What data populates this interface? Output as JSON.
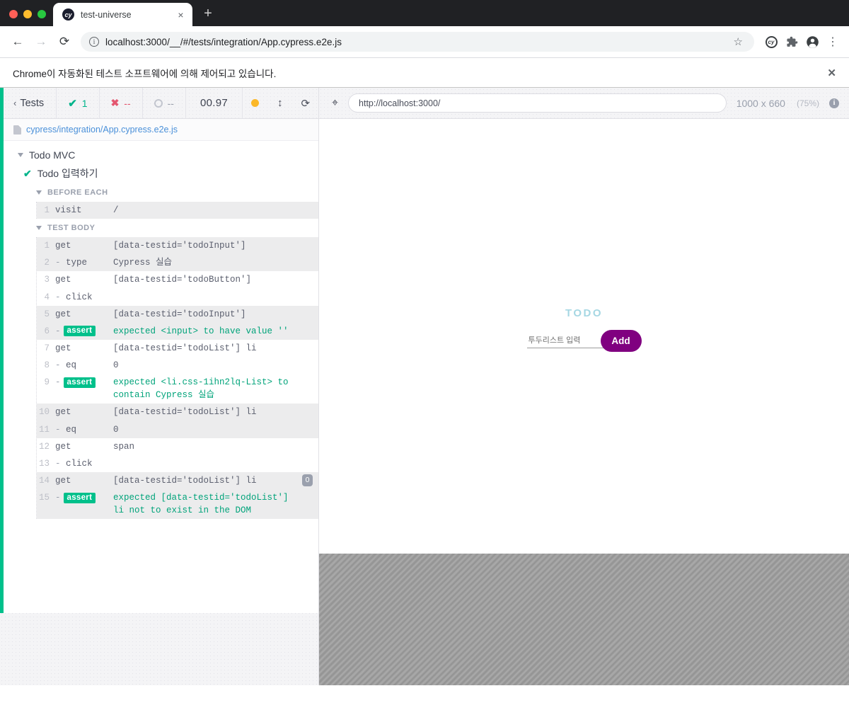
{
  "browser": {
    "tab": {
      "title": "test-universe",
      "favicon": "cy",
      "close": "×"
    },
    "new_tab": "+",
    "nav": {
      "back": "←",
      "forward": "→",
      "reload": "⟳"
    },
    "omnibox": {
      "info": "i",
      "url": "localhost:3000/__/#/tests/integration/App.cypress.e2e.js",
      "star": "☆"
    },
    "toolbar_icons": {
      "extension_cy": "cy",
      "puzzle": "❖",
      "profile": "●",
      "menu": "⋮"
    },
    "automation_notice": {
      "text": "Chrome이 자동화된 테스트 소프트웨어에 의해 제어되고 있습니다.",
      "close": "✕"
    }
  },
  "reporter": {
    "header": {
      "back_chevron": "‹",
      "tests_label": "Tests",
      "pass_icon": "✔",
      "pass_count": "1",
      "fail_icon": "✖",
      "fail_count": "--",
      "pending_count": "--",
      "duration": "00.97",
      "auto_scroll_icon": "↕",
      "restart_icon": "⟳"
    },
    "spec_path": "cypress/integration/App.cypress.e2e.js",
    "suite": {
      "name": "Todo MVC"
    },
    "test": {
      "name": "Todo 입력하기"
    },
    "hooks": [
      {
        "label": "BEFORE EACH",
        "commands": [
          {
            "num": "1",
            "name": "visit",
            "message": "/",
            "type": "parent",
            "alt": true,
            "badge": ""
          }
        ]
      },
      {
        "label": "TEST BODY",
        "commands": [
          {
            "num": "1",
            "name": "get",
            "message": "[data-testid='todoInput']",
            "type": "parent",
            "alt": true,
            "badge": ""
          },
          {
            "num": "2",
            "name": "type",
            "message": "Cypress 실습",
            "type": "child",
            "alt": true,
            "badge": ""
          },
          {
            "num": "3",
            "name": "get",
            "message": "[data-testid='todoButton']",
            "type": "parent",
            "alt": false,
            "badge": ""
          },
          {
            "num": "4",
            "name": "click",
            "message": "",
            "type": "child",
            "alt": false,
            "badge": ""
          },
          {
            "num": "5",
            "name": "get",
            "message": "[data-testid='todoInput']",
            "type": "parent",
            "alt": true,
            "badge": ""
          },
          {
            "num": "6",
            "name": "assert",
            "message": "expected <input> to have value ''",
            "type": "assert",
            "alt": true,
            "badge": ""
          },
          {
            "num": "7",
            "name": "get",
            "message": "[data-testid='todoList'] li",
            "type": "parent",
            "alt": false,
            "badge": ""
          },
          {
            "num": "8",
            "name": "eq",
            "message": "0",
            "type": "child",
            "alt": false,
            "badge": ""
          },
          {
            "num": "9",
            "name": "assert",
            "message": "expected <li.css-1ihn2lq-List> to contain Cypress 실습",
            "type": "assert",
            "alt": false,
            "badge": ""
          },
          {
            "num": "10",
            "name": "get",
            "message": "[data-testid='todoList'] li",
            "type": "parent",
            "alt": true,
            "badge": ""
          },
          {
            "num": "11",
            "name": "eq",
            "message": "0",
            "type": "child",
            "alt": true,
            "badge": ""
          },
          {
            "num": "12",
            "name": "get",
            "message": "span",
            "type": "parent",
            "alt": false,
            "badge": ""
          },
          {
            "num": "13",
            "name": "click",
            "message": "",
            "type": "child",
            "alt": false,
            "badge": ""
          },
          {
            "num": "14",
            "name": "get",
            "message": "[data-testid='todoList'] li",
            "type": "parent",
            "alt": true,
            "badge": "0"
          },
          {
            "num": "15",
            "name": "assert",
            "message": "expected [data-testid='todoList'] li not to exist in the DOM",
            "type": "assert",
            "alt": true,
            "badge": ""
          }
        ]
      }
    ],
    "assert_tag_label": "assert"
  },
  "preview": {
    "selector_icon": "⌖",
    "url": "http://localhost:3000/",
    "viewport_size": "1000 x 660",
    "viewport_scale": "(75%)",
    "info": "i"
  },
  "todo_app": {
    "heading": "TODO",
    "input_placeholder": "투두리스트 입력",
    "input_value": "",
    "add_label": "Add"
  },
  "colors": {
    "accent_green": "#00c08b",
    "fail_red": "#e45770",
    "todo_heading": "#a6d7e3",
    "add_button": "#800080",
    "auto_dot": "#fbb829"
  }
}
